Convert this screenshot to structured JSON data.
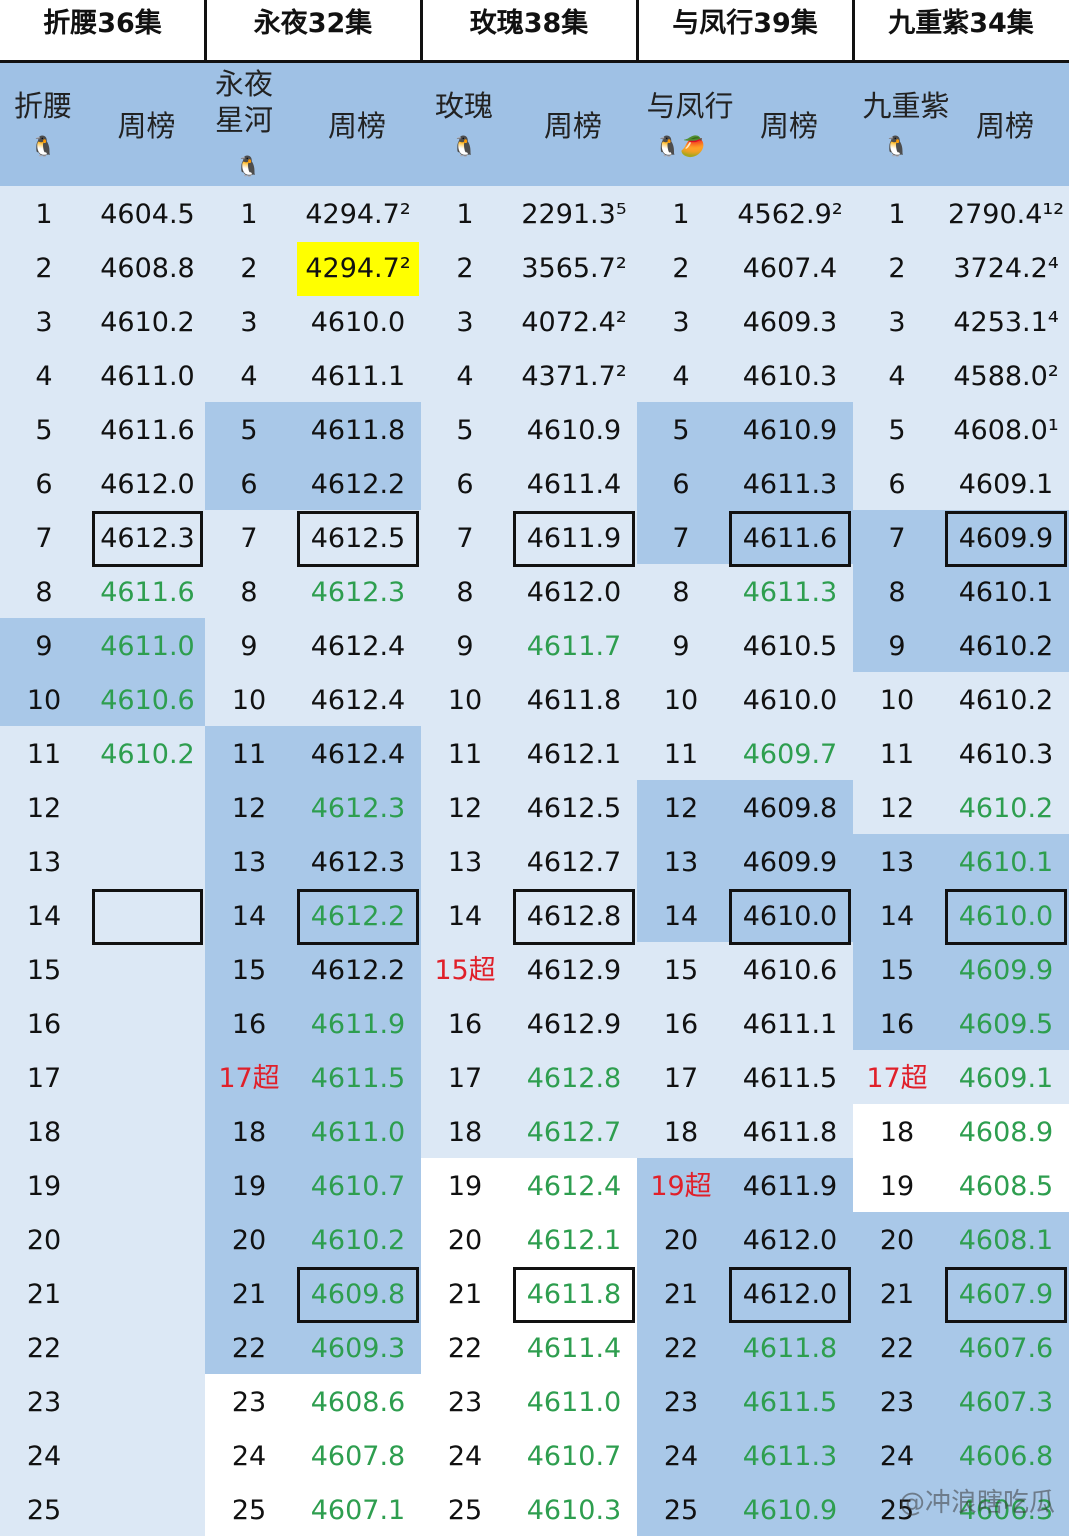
{
  "colors": {
    "band_dark": "#a9c8e8",
    "band_light": "#dce8f5",
    "header_band": "#9fc1e5",
    "green_text": "#2e9e4f",
    "red_text": "#e0202a",
    "highlight": "#ffff00"
  },
  "columns": [
    {
      "title": "折腰36集",
      "rank_header": "折腰",
      "rank_header_icon": "🐧",
      "value_header": "周榜",
      "rows": [
        {
          "rank": "1",
          "value": "4604.5"
        },
        {
          "rank": "2",
          "value": "4608.8"
        },
        {
          "rank": "3",
          "value": "4610.2"
        },
        {
          "rank": "4",
          "value": "4611.0"
        },
        {
          "rank": "5",
          "value": "4611.6"
        },
        {
          "rank": "6",
          "value": "4612.0"
        },
        {
          "rank": "7",
          "value": "4612.3",
          "boxed": true
        },
        {
          "rank": "8",
          "value": "4611.6",
          "green": true
        },
        {
          "rank": "9",
          "value": "4611.0",
          "green": true
        },
        {
          "rank": "10",
          "value": "4610.6",
          "green": true
        },
        {
          "rank": "11",
          "value": "4610.2",
          "green": true
        },
        {
          "rank": "12",
          "value": ""
        },
        {
          "rank": "13",
          "value": ""
        },
        {
          "rank": "14",
          "value": "",
          "boxed": true
        },
        {
          "rank": "15",
          "value": ""
        },
        {
          "rank": "16",
          "value": ""
        },
        {
          "rank": "17",
          "value": ""
        },
        {
          "rank": "18",
          "value": ""
        },
        {
          "rank": "19",
          "value": ""
        },
        {
          "rank": "20",
          "value": ""
        },
        {
          "rank": "21",
          "value": ""
        },
        {
          "rank": "22",
          "value": ""
        },
        {
          "rank": "23",
          "value": ""
        },
        {
          "rank": "24",
          "value": ""
        },
        {
          "rank": "25",
          "value": ""
        }
      ]
    },
    {
      "title": "永夜32集",
      "rank_header": "永夜星河",
      "rank_header_icon": "🐧",
      "value_header": "周榜",
      "rows": [
        {
          "rank": "1",
          "value": "4294.7²"
        },
        {
          "rank": "2",
          "value": "4294.7²",
          "highlight": true
        },
        {
          "rank": "3",
          "value": "4610.0"
        },
        {
          "rank": "4",
          "value": "4611.1"
        },
        {
          "rank": "5",
          "value": "4611.8"
        },
        {
          "rank": "6",
          "value": "4612.2"
        },
        {
          "rank": "7",
          "value": "4612.5",
          "boxed": true
        },
        {
          "rank": "8",
          "value": "4612.3",
          "green": true
        },
        {
          "rank": "9",
          "value": "4612.4"
        },
        {
          "rank": "10",
          "value": "4612.4"
        },
        {
          "rank": "11",
          "value": "4612.4"
        },
        {
          "rank": "12",
          "value": "4612.3",
          "green": true
        },
        {
          "rank": "13",
          "value": "4612.3"
        },
        {
          "rank": "14",
          "value": "4612.2",
          "green": true,
          "boxed": true
        },
        {
          "rank": "15",
          "value": "4612.2"
        },
        {
          "rank": "16",
          "value": "4611.9",
          "green": true
        },
        {
          "rank": "17超",
          "value": "4611.5",
          "green": true,
          "red_rank": true
        },
        {
          "rank": "18",
          "value": "4611.0",
          "green": true
        },
        {
          "rank": "19",
          "value": "4610.7",
          "green": true
        },
        {
          "rank": "20",
          "value": "4610.2",
          "green": true
        },
        {
          "rank": "21",
          "value": "4609.8",
          "green": true,
          "boxed": true
        },
        {
          "rank": "22",
          "value": "4609.3",
          "green": true
        },
        {
          "rank": "23",
          "value": "4608.6",
          "green": true
        },
        {
          "rank": "24",
          "value": "4607.8",
          "green": true
        },
        {
          "rank": "25",
          "value": "4607.1",
          "green": true
        }
      ]
    },
    {
      "title": "玫瑰38集",
      "rank_header": "玫瑰",
      "rank_header_icon": "🐧",
      "value_header": "周榜",
      "rows": [
        {
          "rank": "1",
          "value": "2291.3⁵"
        },
        {
          "rank": "2",
          "value": "3565.7²"
        },
        {
          "rank": "3",
          "value": "4072.4²"
        },
        {
          "rank": "4",
          "value": "4371.7²"
        },
        {
          "rank": "5",
          "value": "4610.9"
        },
        {
          "rank": "6",
          "value": "4611.4"
        },
        {
          "rank": "7",
          "value": "4611.9",
          "boxed": true
        },
        {
          "rank": "8",
          "value": "4612.0"
        },
        {
          "rank": "9",
          "value": "4611.7",
          "green": true
        },
        {
          "rank": "10",
          "value": "4611.8"
        },
        {
          "rank": "11",
          "value": "4612.1"
        },
        {
          "rank": "12",
          "value": "4612.5"
        },
        {
          "rank": "13",
          "value": "4612.7"
        },
        {
          "rank": "14",
          "value": "4612.8",
          "boxed": true
        },
        {
          "rank": "15超",
          "value": "4612.9",
          "red_rank": true
        },
        {
          "rank": "16",
          "value": "4612.9"
        },
        {
          "rank": "17",
          "value": "4612.8",
          "green": true
        },
        {
          "rank": "18",
          "value": "4612.7",
          "green": true
        },
        {
          "rank": "19",
          "value": "4612.4",
          "green": true
        },
        {
          "rank": "20",
          "value": "4612.1",
          "green": true
        },
        {
          "rank": "21",
          "value": "4611.8",
          "green": true,
          "boxed": true
        },
        {
          "rank": "22",
          "value": "4611.4",
          "green": true
        },
        {
          "rank": "23",
          "value": "4611.0",
          "green": true
        },
        {
          "rank": "24",
          "value": "4610.7",
          "green": true
        },
        {
          "rank": "25",
          "value": "4610.3",
          "green": true
        }
      ]
    },
    {
      "title": "与凤行39集",
      "rank_header": "与凤行",
      "rank_header_icon": "🐧🥭",
      "value_header": "周榜",
      "rows": [
        {
          "rank": "1",
          "value": "4562.9²"
        },
        {
          "rank": "2",
          "value": "4607.4"
        },
        {
          "rank": "3",
          "value": "4609.3"
        },
        {
          "rank": "4",
          "value": "4610.3"
        },
        {
          "rank": "5",
          "value": "4610.9"
        },
        {
          "rank": "6",
          "value": "4611.3"
        },
        {
          "rank": "7",
          "value": "4611.6",
          "boxed": true
        },
        {
          "rank": "8",
          "value": "4611.3",
          "green": true
        },
        {
          "rank": "9",
          "value": "4610.5"
        },
        {
          "rank": "10",
          "value": "4610.0"
        },
        {
          "rank": "11",
          "value": "4609.7",
          "green": true
        },
        {
          "rank": "12",
          "value": "4609.8"
        },
        {
          "rank": "13",
          "value": "4609.9"
        },
        {
          "rank": "14",
          "value": "4610.0",
          "boxed": true
        },
        {
          "rank": "15",
          "value": "4610.6"
        },
        {
          "rank": "16",
          "value": "4611.1"
        },
        {
          "rank": "17",
          "value": "4611.5"
        },
        {
          "rank": "18",
          "value": "4611.8"
        },
        {
          "rank": "19超",
          "value": "4611.9",
          "red_rank": true
        },
        {
          "rank": "20",
          "value": "4612.0"
        },
        {
          "rank": "21",
          "value": "4612.0",
          "boxed": true
        },
        {
          "rank": "22",
          "value": "4611.8",
          "green": true
        },
        {
          "rank": "23",
          "value": "4611.5",
          "green": true
        },
        {
          "rank": "24",
          "value": "4611.3",
          "green": true
        },
        {
          "rank": "25",
          "value": "4610.9",
          "green": true
        }
      ]
    },
    {
      "title": "九重紫34集",
      "rank_header": "九重紫",
      "rank_header_icon": "🐧",
      "value_header": "周榜",
      "rows": [
        {
          "rank": "1",
          "value": "2790.4¹²"
        },
        {
          "rank": "2",
          "value": "3724.2⁴"
        },
        {
          "rank": "3",
          "value": "4253.1⁴"
        },
        {
          "rank": "4",
          "value": "4588.0²"
        },
        {
          "rank": "5",
          "value": "4608.0¹"
        },
        {
          "rank": "6",
          "value": "4609.1"
        },
        {
          "rank": "7",
          "value": "4609.9",
          "boxed": true
        },
        {
          "rank": "8",
          "value": "4610.1"
        },
        {
          "rank": "9",
          "value": "4610.2"
        },
        {
          "rank": "10",
          "value": "4610.2"
        },
        {
          "rank": "11",
          "value": "4610.3"
        },
        {
          "rank": "12",
          "value": "4610.2",
          "green": true
        },
        {
          "rank": "13",
          "value": "4610.1",
          "green": true
        },
        {
          "rank": "14",
          "value": "4610.0",
          "green": true,
          "boxed": true
        },
        {
          "rank": "15",
          "value": "4609.9",
          "green": true
        },
        {
          "rank": "16",
          "value": "4609.5",
          "green": true
        },
        {
          "rank": "17超",
          "value": "4609.1",
          "green": true,
          "red_rank": true
        },
        {
          "rank": "18",
          "value": "4608.9",
          "green": true
        },
        {
          "rank": "19",
          "value": "4608.5",
          "green": true
        },
        {
          "rank": "20",
          "value": "4608.1",
          "green": true
        },
        {
          "rank": "21",
          "value": "4607.9",
          "green": true,
          "boxed": true
        },
        {
          "rank": "22",
          "value": "4607.6",
          "green": true
        },
        {
          "rank": "23",
          "value": "4607.3",
          "green": true
        },
        {
          "rank": "24",
          "value": "4606.8",
          "green": true
        },
        {
          "rank": "25",
          "value": "4606.3",
          "green": true
        }
      ]
    }
  ],
  "watermark": "@冲浪瞎吃瓜"
}
